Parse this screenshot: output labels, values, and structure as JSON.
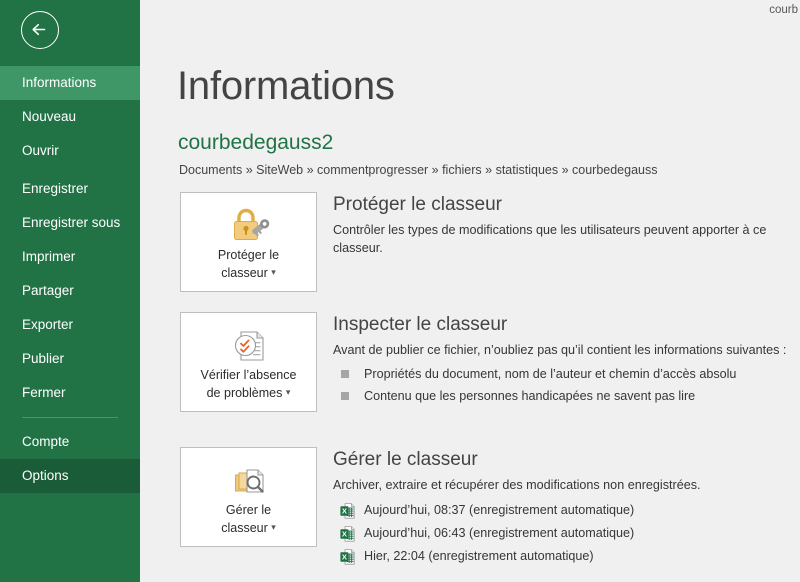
{
  "window": {
    "title_fragment": "courb"
  },
  "sidebar": {
    "back_label": "back-arrow",
    "items": [
      {
        "label": "Informations",
        "state": "selected"
      },
      {
        "label": "Nouveau",
        "state": "normal"
      },
      {
        "label": "Ouvrir",
        "state": "normal"
      },
      {
        "label": "Enregistrer",
        "state": "normal"
      },
      {
        "label": "Enregistrer sous",
        "state": "normal"
      },
      {
        "label": "Imprimer",
        "state": "normal"
      },
      {
        "label": "Partager",
        "state": "normal"
      },
      {
        "label": "Exporter",
        "state": "normal"
      },
      {
        "label": "Publier",
        "state": "normal"
      },
      {
        "label": "Fermer",
        "state": "normal"
      },
      {
        "label": "Compte",
        "state": "normal"
      },
      {
        "label": "Options",
        "state": "hovered"
      }
    ],
    "colors": {
      "base": "#217346",
      "selected": "#3f9768",
      "hovered": "#1a5c38",
      "separator": "#4d9270"
    }
  },
  "header": {
    "title": "Informations",
    "document_name": "courbedegauss2",
    "breadcrumb": "Documents » SiteWeb » commentprogresser » fichiers » statistiques » courbedegauss"
  },
  "sections": {
    "protect": {
      "button_label": "Protéger le\nclasseur",
      "button_label_line1": "Protéger le",
      "button_label_line2": "classeur",
      "icon": "padlock-key-icon",
      "title": "Protéger le classeur",
      "description": "Contrôler les types de modifications que les utilisateurs peuvent apporter à ce classeur."
    },
    "inspect": {
      "button_label_line1": "Vérifier l’absence",
      "button_label_line2": "de problèmes",
      "icon": "document-inspect-icon",
      "title": "Inspecter le classeur",
      "description": "Avant de publier ce fichier, n’oubliez pas qu’il contient les informations suivantes :",
      "bullets": [
        "Propriétés du document, nom de l’auteur et chemin d’accès absolu",
        "Contenu que les personnes handicapées ne savent pas lire"
      ]
    },
    "manage": {
      "button_label_line1": "Gérer le",
      "button_label_line2": "classeur",
      "icon": "document-stack-search-icon",
      "title": "Gérer le classeur",
      "description": "Archiver, extraire et récupérer des modifications non enregistrées.",
      "versions": [
        "Aujourd’hui, 08:37 (enregistrement automatique)",
        "Aujourd’hui, 06:43 (enregistrement automatique)",
        "Hier, 22:04 (enregistrement automatique)"
      ]
    }
  },
  "colors": {
    "accent_green": "#217346",
    "page_bg": "#f0f0f0",
    "card_bg": "#ffffff",
    "card_border": "#bfbfbf",
    "text": "#363636",
    "heading": "#444444",
    "bullet": "#a6a6a6"
  }
}
